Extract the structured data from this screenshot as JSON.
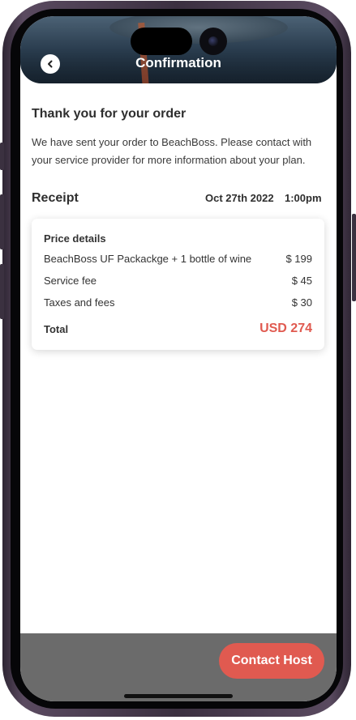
{
  "header": {
    "title": "Confirmation",
    "back_icon": "chevron-left-icon"
  },
  "confirmation": {
    "heading": "Thank you for your order",
    "message": "We have sent your order to BeachBoss. Please contact with your service provider for more information about your plan."
  },
  "receipt": {
    "label": "Receipt",
    "date": "Oct 27th 2022",
    "time": "1:00pm"
  },
  "price_details": {
    "title": "Price details",
    "items": [
      {
        "label": "BeachBoss UF Packackge + 1 bottle of wine",
        "amount": "$ 199"
      },
      {
        "label": "Service fee",
        "amount": "$ 45"
      },
      {
        "label": "Taxes and fees",
        "amount": "$ 30"
      }
    ],
    "total_label": "Total",
    "total_value": "USD 274"
  },
  "actions": {
    "contact_label": "Contact Host"
  },
  "colors": {
    "accent": "#e05a50",
    "bottom_bar": "#6b6b6b",
    "text": "#2e2e2e"
  }
}
